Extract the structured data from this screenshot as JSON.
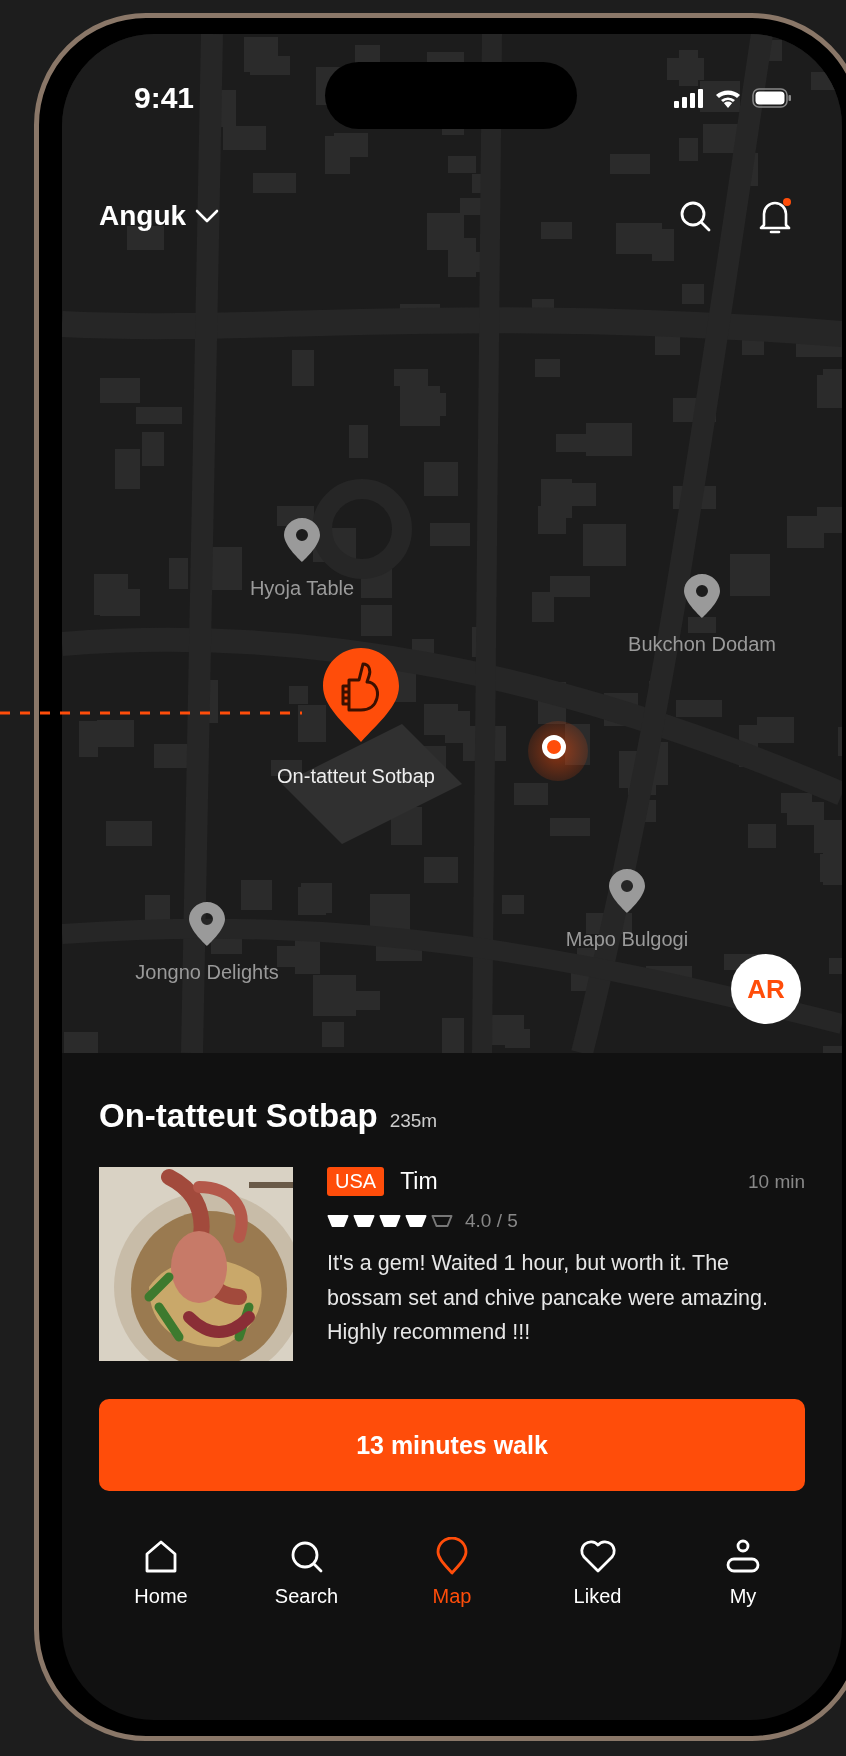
{
  "status_bar": {
    "time": "9:41"
  },
  "header": {
    "location": "Anguk",
    "notification_unread": true
  },
  "map": {
    "places": [
      {
        "label": "Hyoja Table",
        "kind": "pin"
      },
      {
        "label": "Bukchon Dodam",
        "kind": "pin"
      },
      {
        "label": "On-tatteut Sotbap",
        "kind": "featured"
      },
      {
        "label": "Mapo Bulgogi",
        "kind": "pin"
      },
      {
        "label": "Jongno Delights",
        "kind": "pin"
      }
    ],
    "ar_button": "AR"
  },
  "place": {
    "name": "On-tatteut Sotbap",
    "distance": "235m",
    "review": {
      "badge": "USA",
      "author": "Tim",
      "time": "10 min",
      "stars": 4,
      "rating": "4.0 / 5",
      "text": "It's a gem! Waited 1 hour, but worth it. The bossam set and chive pancake were amazing. Highly recommend !!!"
    }
  },
  "action_button": "13 minutes walk",
  "nav": [
    {
      "label": "Home",
      "selected": false
    },
    {
      "label": "Search",
      "selected": false
    },
    {
      "label": "Map",
      "selected": true
    },
    {
      "label": "Liked",
      "selected": false
    },
    {
      "label": "My",
      "selected": false
    }
  ]
}
